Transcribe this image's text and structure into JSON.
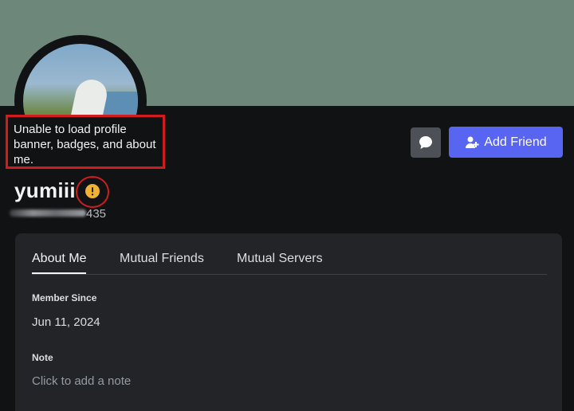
{
  "profile": {
    "error_message": "Unable to load profile banner, badges, and about me.",
    "username": "yumiii",
    "tag_suffix": "435",
    "warning_icon": "exclamation-circle-icon",
    "colors": {
      "banner": "#6d877a",
      "background": "#111214",
      "panel": "#232428",
      "accent": "#5865f2",
      "warning": "#f0b232",
      "highlight": "#d01c1c"
    }
  },
  "actions": {
    "message_icon": "chat-bubble-icon",
    "add_friend_icon": "add-user-icon",
    "add_friend_label": "Add Friend"
  },
  "tabs": [
    {
      "label": "About Me",
      "active": true
    },
    {
      "label": "Mutual Friends",
      "active": false
    },
    {
      "label": "Mutual Servers",
      "active": false
    }
  ],
  "about": {
    "member_since_label": "Member Since",
    "member_since_value": "Jun 11, 2024",
    "note_label": "Note",
    "note_placeholder": "Click to add a note"
  }
}
